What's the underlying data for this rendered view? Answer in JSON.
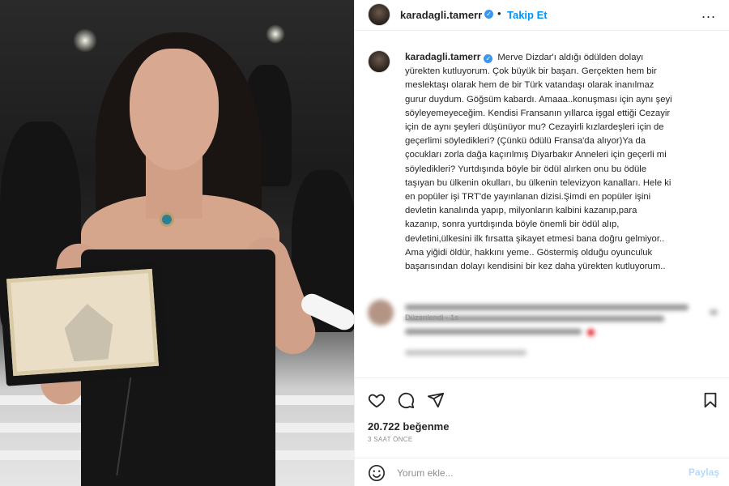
{
  "post": {
    "photo_alt": "",
    "header": {
      "username": "karadagli.tamerr",
      "separator": "•",
      "follow_label": "Takip Et",
      "more_label": "..."
    },
    "caption": {
      "username": "karadagli.tamerr",
      "text": "Merve Dizdar'ı aldığı ödülden dolayı\nyürekten kutluyorum. Çok büyük bir başarı. Gerçekten hem bir\nmeslektaşı olarak hem de bir Türk vatandaşı olarak inanılmaz\ngurur duydum. Göğsüm kabardı. Amaaa..konuşması için aynı şeyi\nsöyleyemeyeceğim. Kendisi Fransanın yıllarca işgal ettiği Cezayir\niçin de aynı şeyleri düşünüyor mu? Cezayirli kızlardeşleri için de\ngeçerlimi söyledikleri? (Çünkü ödülü Fransa'da alıyor)Ya da\nçocukları zorla dağa kaçırılmış Diyarbakır Anneleri için geçerli mi\nsöyledikleri? Yurtdışında böyle bir ödül alırken onu bu ödüle\ntaşıyan bu ülkenin okulları, bu ülkenin televizyon kanalları. Hele ki\nen popüler işi TRT'de yayınlanan dizisi.Şimdi en popüler işini\ndevletin kanalında yapıp, milyonların kalbini kazanıp,para\nkazanıp, sonra yurtdışında böyle önemli bir ödül alıp,\ndevletini,ülkesini ilk fırsatta şikayet etmesi bana doğru gelmiyor..\nAma yiğidi öldür, hakkını yeme.. Göstermiş olduğu oyunculuk\nbaşarısından dolayı kendisini bir kez daha yürekten kutluyorum..",
      "meta": "Düzenlendi · 1s"
    },
    "likes": {
      "count": "20.722",
      "label": "beğenme"
    },
    "time_ago": "3 SAAT ÖNCE",
    "comment_box": {
      "placeholder": "Yorum ekle...",
      "post_label": "Paylaş"
    }
  },
  "icons": {
    "verified": "verified-badge-icon",
    "like": "heart-icon",
    "comment": "comment-bubble-icon",
    "share": "paper-plane-icon",
    "save": "bookmark-icon",
    "emoji": "smiley-icon"
  },
  "colors": {
    "accent": "#0095f6",
    "verified": "#3897f0",
    "post_disabled": "#b3dbff",
    "muted": "#8e8e8e"
  }
}
